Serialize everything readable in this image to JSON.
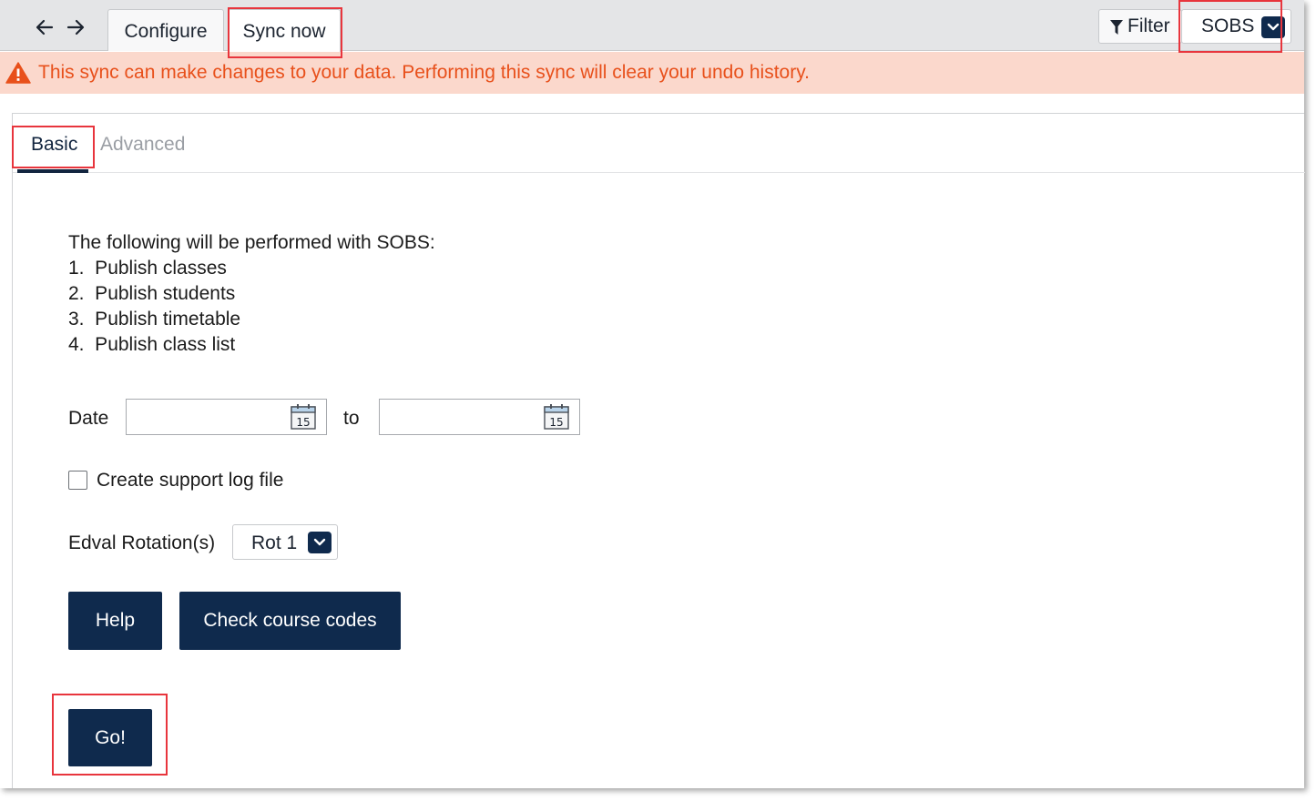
{
  "toolbar": {
    "tabs": [
      {
        "label": "Configure"
      },
      {
        "label": "Sync now"
      }
    ],
    "filter_label": "Filter",
    "integration_select": "SOBS"
  },
  "warning": {
    "text": "This sync can make changes to your data. Performing this sync will clear your undo history."
  },
  "subtabs": [
    {
      "label": "Basic"
    },
    {
      "label": "Advanced"
    }
  ],
  "main": {
    "intro": "The following will be performed with SOBS:",
    "steps": [
      "1.  Publish classes",
      "2.  Publish students",
      "3.  Publish timetable",
      "4.  Publish class list"
    ],
    "date_label": "Date",
    "to_label": "to",
    "date_from_value": "",
    "date_to_value": "",
    "calendar_icon_text": "15",
    "support_log_label": "Create support log file",
    "support_log_checked": false,
    "rotation_label": "Edval Rotation(s)",
    "rotation_value": "Rot 1",
    "help_button": "Help",
    "check_codes_button": "Check course codes",
    "go_button": "Go!"
  },
  "colors": {
    "primary": "#0f2a4d",
    "warning_text": "#e8501b",
    "warning_bg": "#fbd8cc",
    "highlight": "#e8353d"
  }
}
